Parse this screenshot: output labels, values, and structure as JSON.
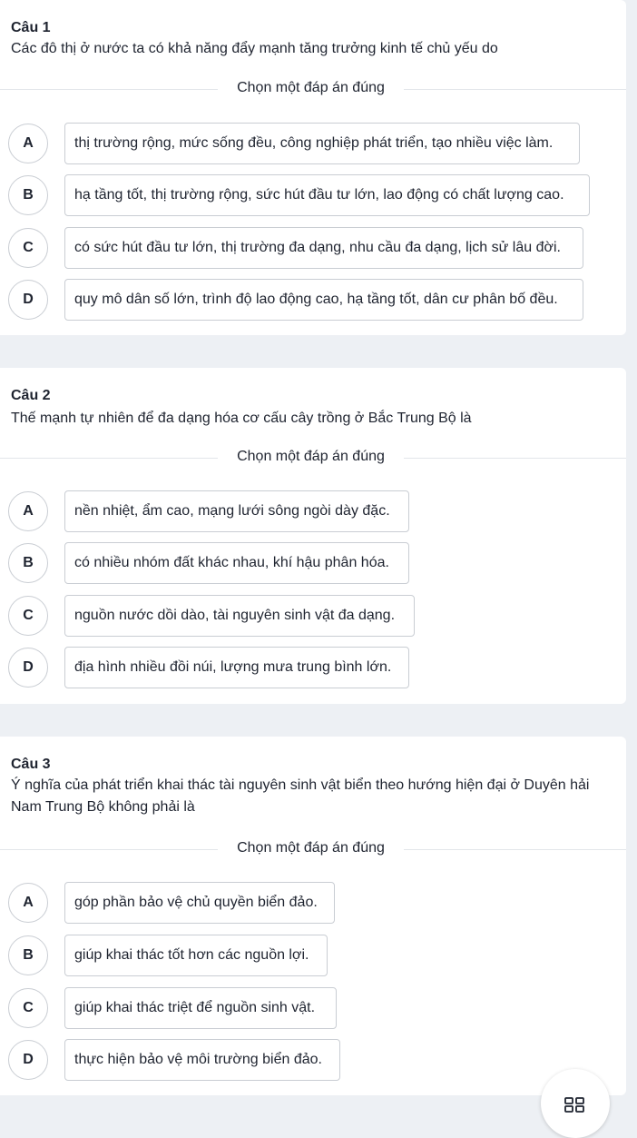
{
  "choose_label": "Chọn một đáp án đúng",
  "questions": [
    {
      "number": "Câu 1",
      "text": "Các đô thị ở nước ta có khả năng đẩy mạnh tăng trưởng kinh tế chủ yếu do",
      "options": [
        {
          "letter": "A",
          "text": "thị trường rộng, mức sống đều, công nghiệp phát triển, tạo nhiều việc làm."
        },
        {
          "letter": "B",
          "text": "hạ tầng tốt, thị trường rộng, sức hút đầu tư lớn, lao động có chất lượng cao."
        },
        {
          "letter": "C",
          "text": "có sức hút đầu tư lớn, thị trường đa dạng, nhu cầu đa dạng, lịch sử lâu đời."
        },
        {
          "letter": "D",
          "text": "quy mô dân số lớn, trình độ lao động cao, hạ tầng tốt, dân cư phân bố đều."
        }
      ]
    },
    {
      "number": "Câu 2",
      "text": "Thế mạnh tự nhiên để đa dạng hóa cơ cấu cây trồng ở Bắc Trung Bộ là",
      "options": [
        {
          "letter": "A",
          "text": "nền nhiệt, ẩm cao, mạng lưới sông ngòi dày đặc."
        },
        {
          "letter": "B",
          "text": "có nhiều nhóm đất khác nhau, khí hậu phân hóa."
        },
        {
          "letter": "C",
          "text": "nguồn nước dồi dào, tài nguyên sinh vật đa dạng."
        },
        {
          "letter": "D",
          "text": "địa hình nhiều đồi núi, lượng mưa trung bình lớn."
        }
      ]
    },
    {
      "number": "Câu 3",
      "text": "Ý nghĩa của phát triển khai thác tài nguyên sinh vật biển theo hướng hiện đại ở Duyên hải Nam Trung Bộ không phải là",
      "options": [
        {
          "letter": "A",
          "text": "góp phần bảo vệ chủ quyền biển đảo."
        },
        {
          "letter": "B",
          "text": "giúp khai thác tốt hơn các nguồn lợi."
        },
        {
          "letter": "C",
          "text": "giúp khai thác triệt để nguồn sinh vật."
        },
        {
          "letter": "D",
          "text": "thực hiện bảo vệ môi trường biển đảo."
        }
      ]
    }
  ],
  "icons": {
    "fab": "grid-menu-icon"
  }
}
